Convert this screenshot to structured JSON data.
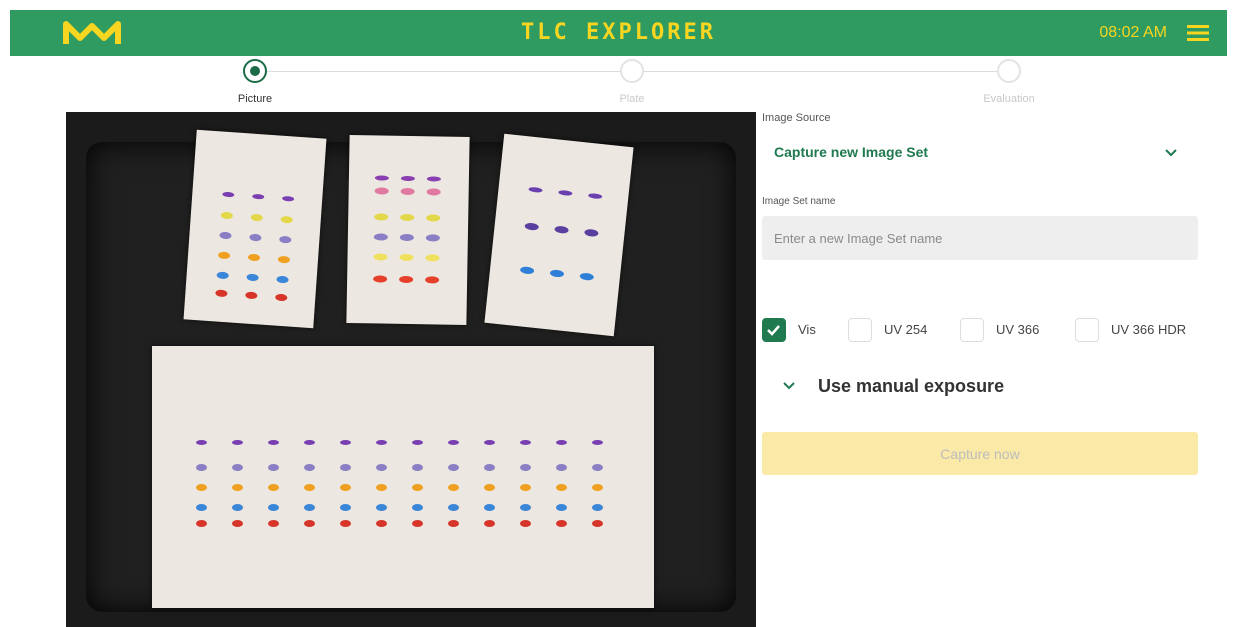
{
  "header": {
    "app_title": "TLC EXPLORER",
    "time": "08:02 AM",
    "logo_icon": "merck-m-logo",
    "menu_icon": "hamburger-menu-icon",
    "bar_color": "#2f9b61",
    "accent_color": "#f7d520"
  },
  "stepper": {
    "steps": [
      {
        "label": "Picture",
        "state": "active"
      },
      {
        "label": "Plate",
        "state": "inactive"
      },
      {
        "label": "Evaluation",
        "state": "inactive"
      }
    ]
  },
  "form": {
    "image_source_label": "Image Source",
    "image_source_value": "Capture new Image Set",
    "image_set_name_label": "Image Set name",
    "image_set_name_value": "",
    "image_set_name_placeholder": "Enter a new Image Set name",
    "modes": [
      {
        "label": "Vis",
        "checked": true
      },
      {
        "label": "UV 254",
        "checked": false
      },
      {
        "label": "UV 366",
        "checked": false
      },
      {
        "label": "UV 366 HDR",
        "checked": false
      }
    ],
    "manual_exposure_label": "Use manual exposure",
    "capture_button_label": "Capture now",
    "primary_color": "#1f7a4f"
  }
}
